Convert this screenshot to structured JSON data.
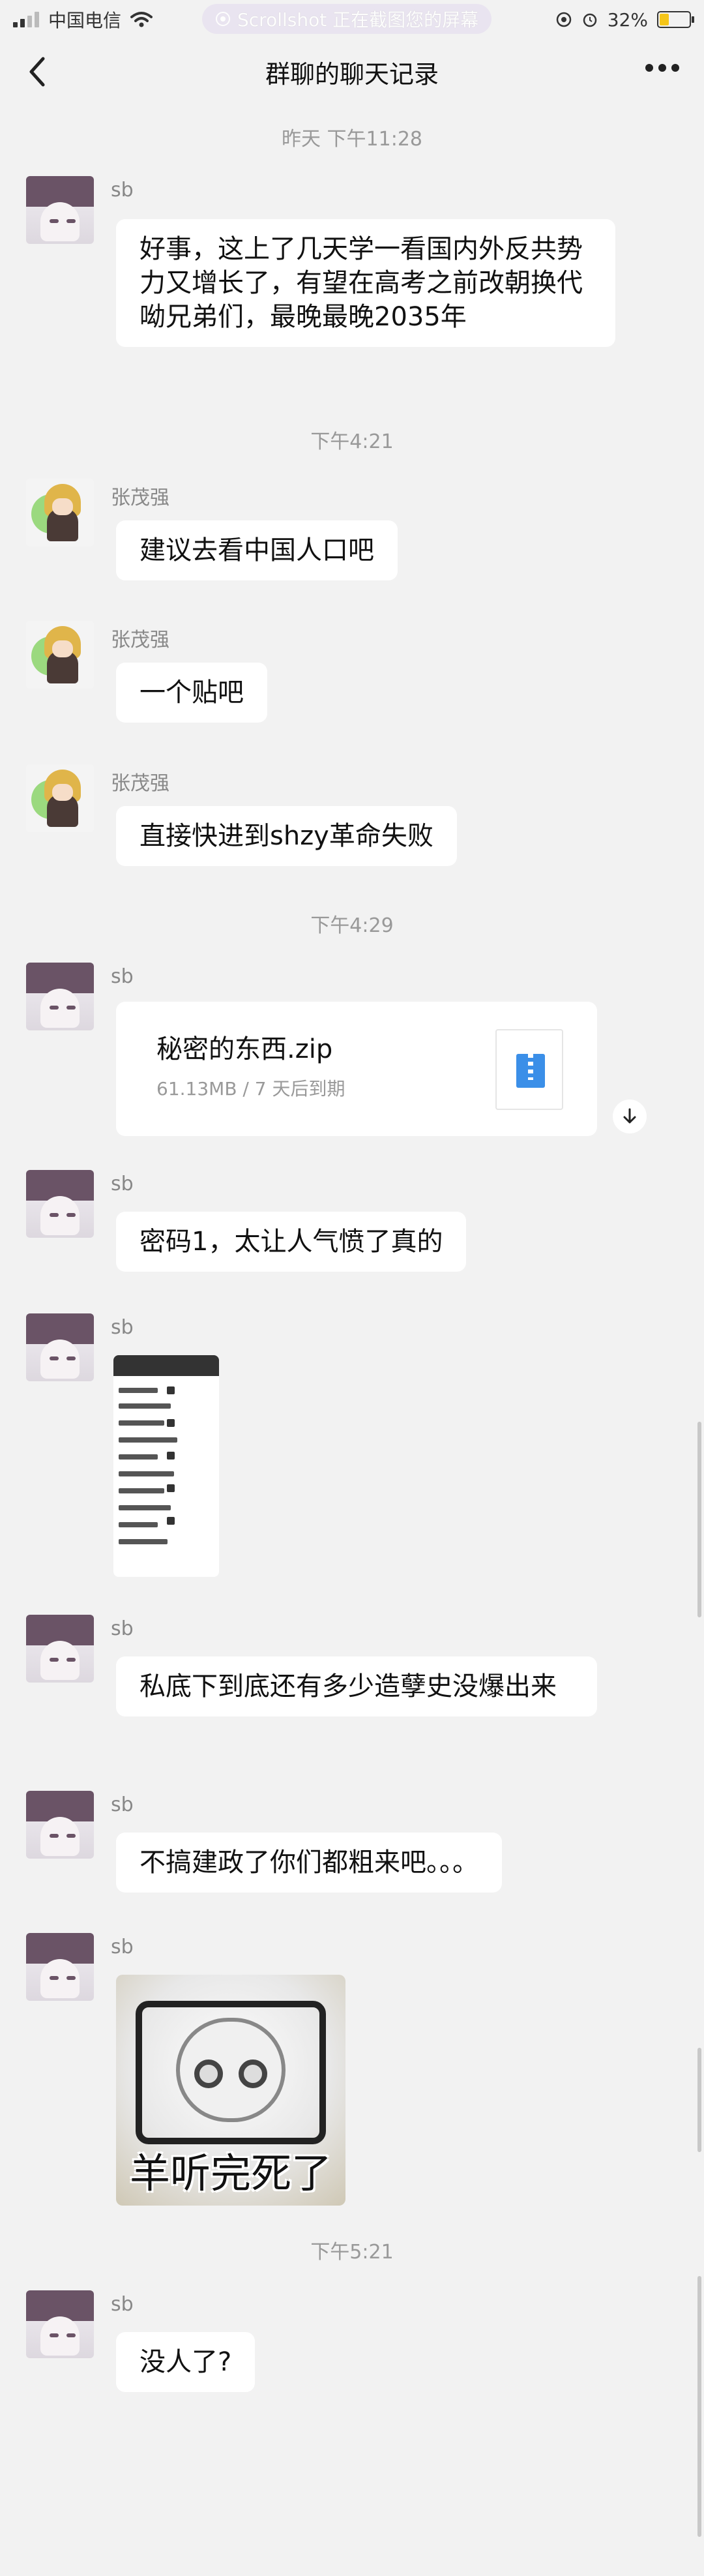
{
  "status_bar": {
    "carrier": "中国电信",
    "notice": "Scrollshot 正在截图您的屏幕",
    "battery": "32%"
  },
  "nav": {
    "title": "群聊的聊天记录"
  },
  "timestamps": [
    "昨天 下午11:28",
    "下午4:21",
    "下午4:29",
    "下午5:21"
  ],
  "messages": [
    {
      "sender": "sb",
      "type": "text",
      "text": "好事，这上了几天学一看国内外反共势力又增长了，有望在高考之前改朝换代呦兄弟们，最晚最晚2035年"
    },
    {
      "sender": "张茂强",
      "type": "text",
      "text": "建议去看中国人口吧"
    },
    {
      "sender": "张茂强",
      "type": "text",
      "text": "一个贴吧"
    },
    {
      "sender": "张茂强",
      "type": "text",
      "text": "直接快进到shzy革命失败"
    },
    {
      "sender": "sb",
      "type": "file",
      "file_name": "秘密的东西.zip",
      "file_meta": "61.13MB / 7 天后到期"
    },
    {
      "sender": "sb",
      "type": "text",
      "text": "密码1，太让人气愤了真的"
    },
    {
      "sender": "sb",
      "type": "image"
    },
    {
      "sender": "sb",
      "type": "text",
      "text": "私底下到底还有多少造孽史没爆出来"
    },
    {
      "sender": "sb",
      "type": "text",
      "text": "不搞建政了你们都粗来吧。。。"
    },
    {
      "sender": "sb",
      "type": "sticker",
      "caption": "羊听完死了"
    },
    {
      "sender": "sb",
      "type": "text",
      "text": "没人了?"
    }
  ],
  "colors": {
    "background": "#f2f2f2",
    "bubble": "#ffffff",
    "zip_icon": "#3b8fe8"
  },
  "icons": [
    "back-arrow-icon",
    "more-icon",
    "wifi-icon",
    "zip-file-icon",
    "download-icon"
  ]
}
